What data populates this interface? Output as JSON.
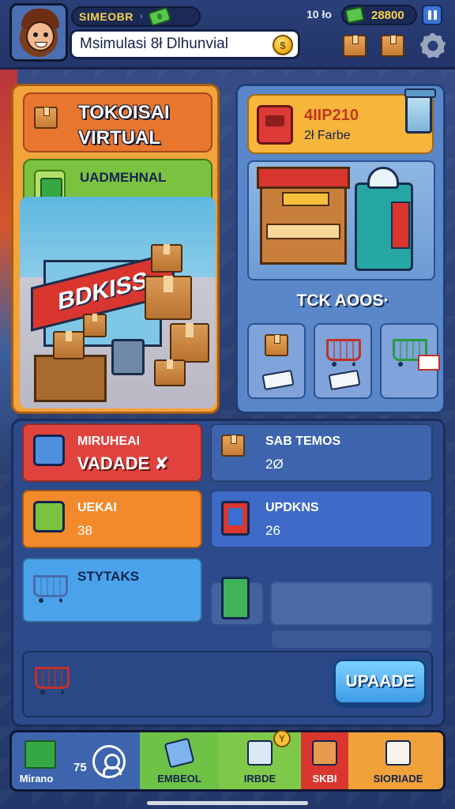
{
  "header": {
    "player_name": "SIMEOBR",
    "title": "Msimulasi 8ł Dlhunvial",
    "left_stat": "10 ło",
    "money": "28800",
    "coin_symbol": "$"
  },
  "left_panel": {
    "title_line1": "TOKOISAI",
    "title_line2": "VIRTUAL",
    "subtitle": "UADMEHNAL",
    "store_sign": "BDKISS"
  },
  "right_panel": {
    "value_line1": "4IIP210",
    "value_line2": "2ł Farbe",
    "label": "TCK AOOS·"
  },
  "stats": [
    {
      "id": "minuhai",
      "title": "MIRUHEAI",
      "value": "VADADE ✘"
    },
    {
      "id": "sabtemos",
      "title": "SAB TEMOS",
      "value": "2Ø"
    },
    {
      "id": "uekai",
      "title": "UEKAI",
      "value": "38"
    },
    {
      "id": "updkns",
      "title": "UPDKNS",
      "value": "26"
    },
    {
      "id": "stytaks",
      "title": "STYTAKS",
      "value": ""
    }
  ],
  "upgrade": {
    "label": "UPAADE"
  },
  "bottom_nav": {
    "items": [
      {
        "label": "Mirano",
        "count": "75"
      },
      {
        "label": "EMBEOL"
      },
      {
        "label": "IRBDE"
      },
      {
        "label": "SKBI"
      },
      {
        "label": "SIORIADE"
      }
    ],
    "badge": "Y"
  },
  "colors": {
    "accent_gold": "#f7d24b",
    "red": "#e0433e",
    "orange": "#f28a2b",
    "blue": "#3e6bc7",
    "green": "#7cc241"
  }
}
